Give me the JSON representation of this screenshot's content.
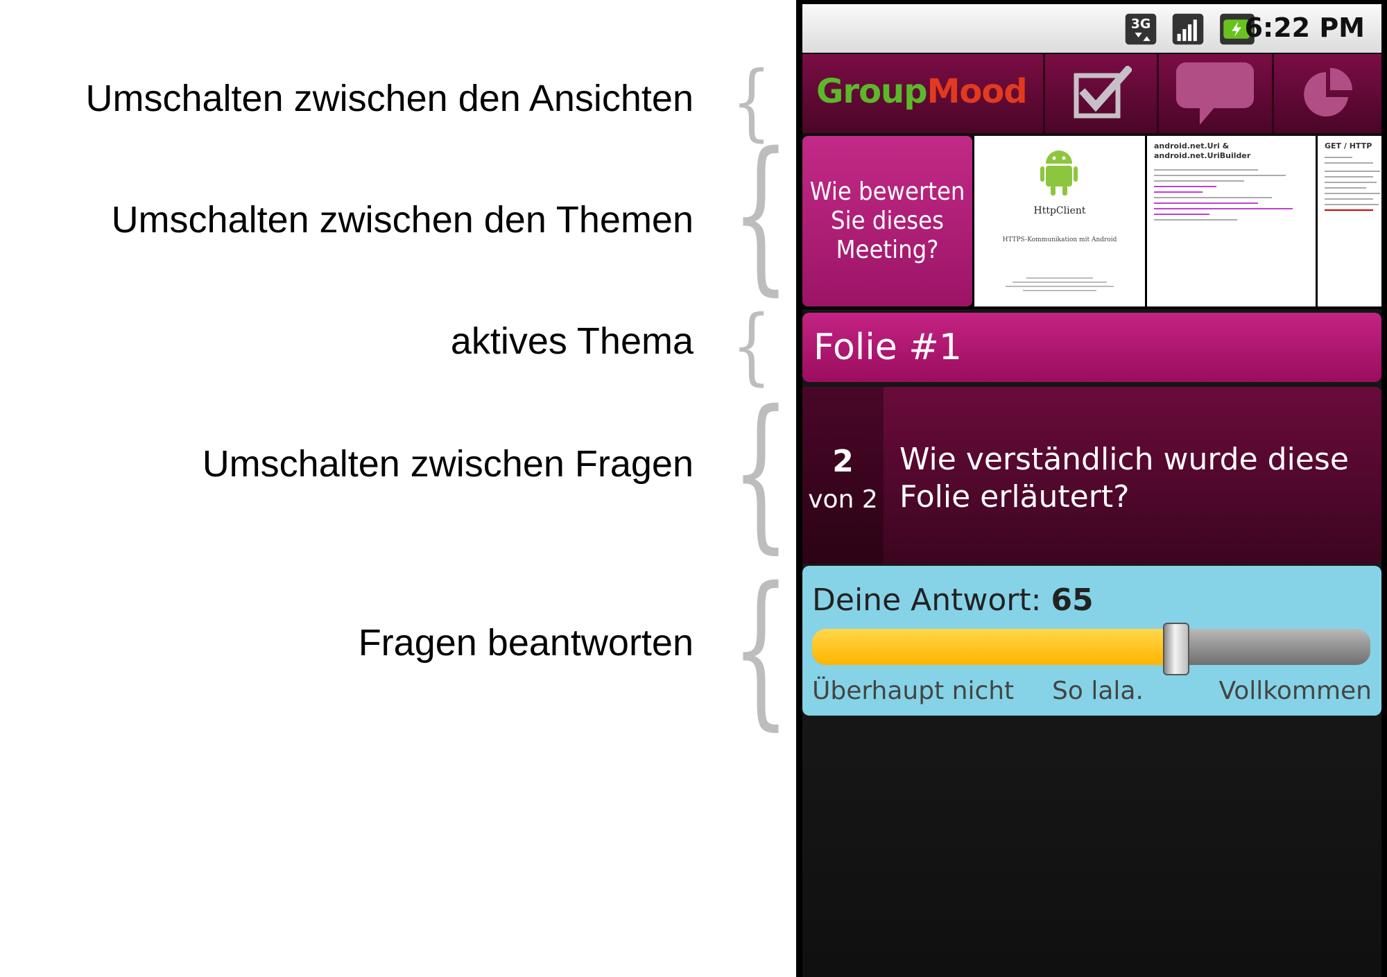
{
  "annotations": [
    {
      "text": "Umschalten zwischen den Ansichten"
    },
    {
      "text": "Umschalten zwischen den Themen"
    },
    {
      "text": "aktives Thema"
    },
    {
      "text": "Umschalten zwischen Fragen"
    },
    {
      "text": "Fragen beantworten"
    }
  ],
  "statusbar": {
    "network": "3G",
    "time": "6:22 PM"
  },
  "app": {
    "logo_part1": "Group",
    "logo_part2": "Mood"
  },
  "nav_tabs": [
    {
      "icon": "checkbox-icon"
    },
    {
      "icon": "speech-bubble-icon"
    },
    {
      "icon": "pie-chart-icon"
    }
  ],
  "topics": {
    "active": "Wie bewerten Sie dieses Meeting?",
    "slide1": {
      "title": "HttpClient",
      "subtitle": "HTTPS-Kommunikation mit Android"
    },
    "slide2": {
      "title": "android.net.Uri & android.net.UriBuilder"
    },
    "slide3": {
      "title": "GET / HTTP"
    }
  },
  "active_slide": "Folie #1",
  "question": {
    "number": "2",
    "of": "von 2",
    "text": "Wie verständlich wurde diese Folie erläutert?"
  },
  "answer": {
    "label": "Deine Antwort:",
    "value": "65",
    "value_fraction": 0.65,
    "scale_min": "Überhaupt nicht",
    "scale_mid": "So lala.",
    "scale_max": "Vollkommen"
  },
  "colors": {
    "accent": "#a8176b",
    "answer_bg": "#86d3e7",
    "slider_fill": "#ffc000"
  }
}
